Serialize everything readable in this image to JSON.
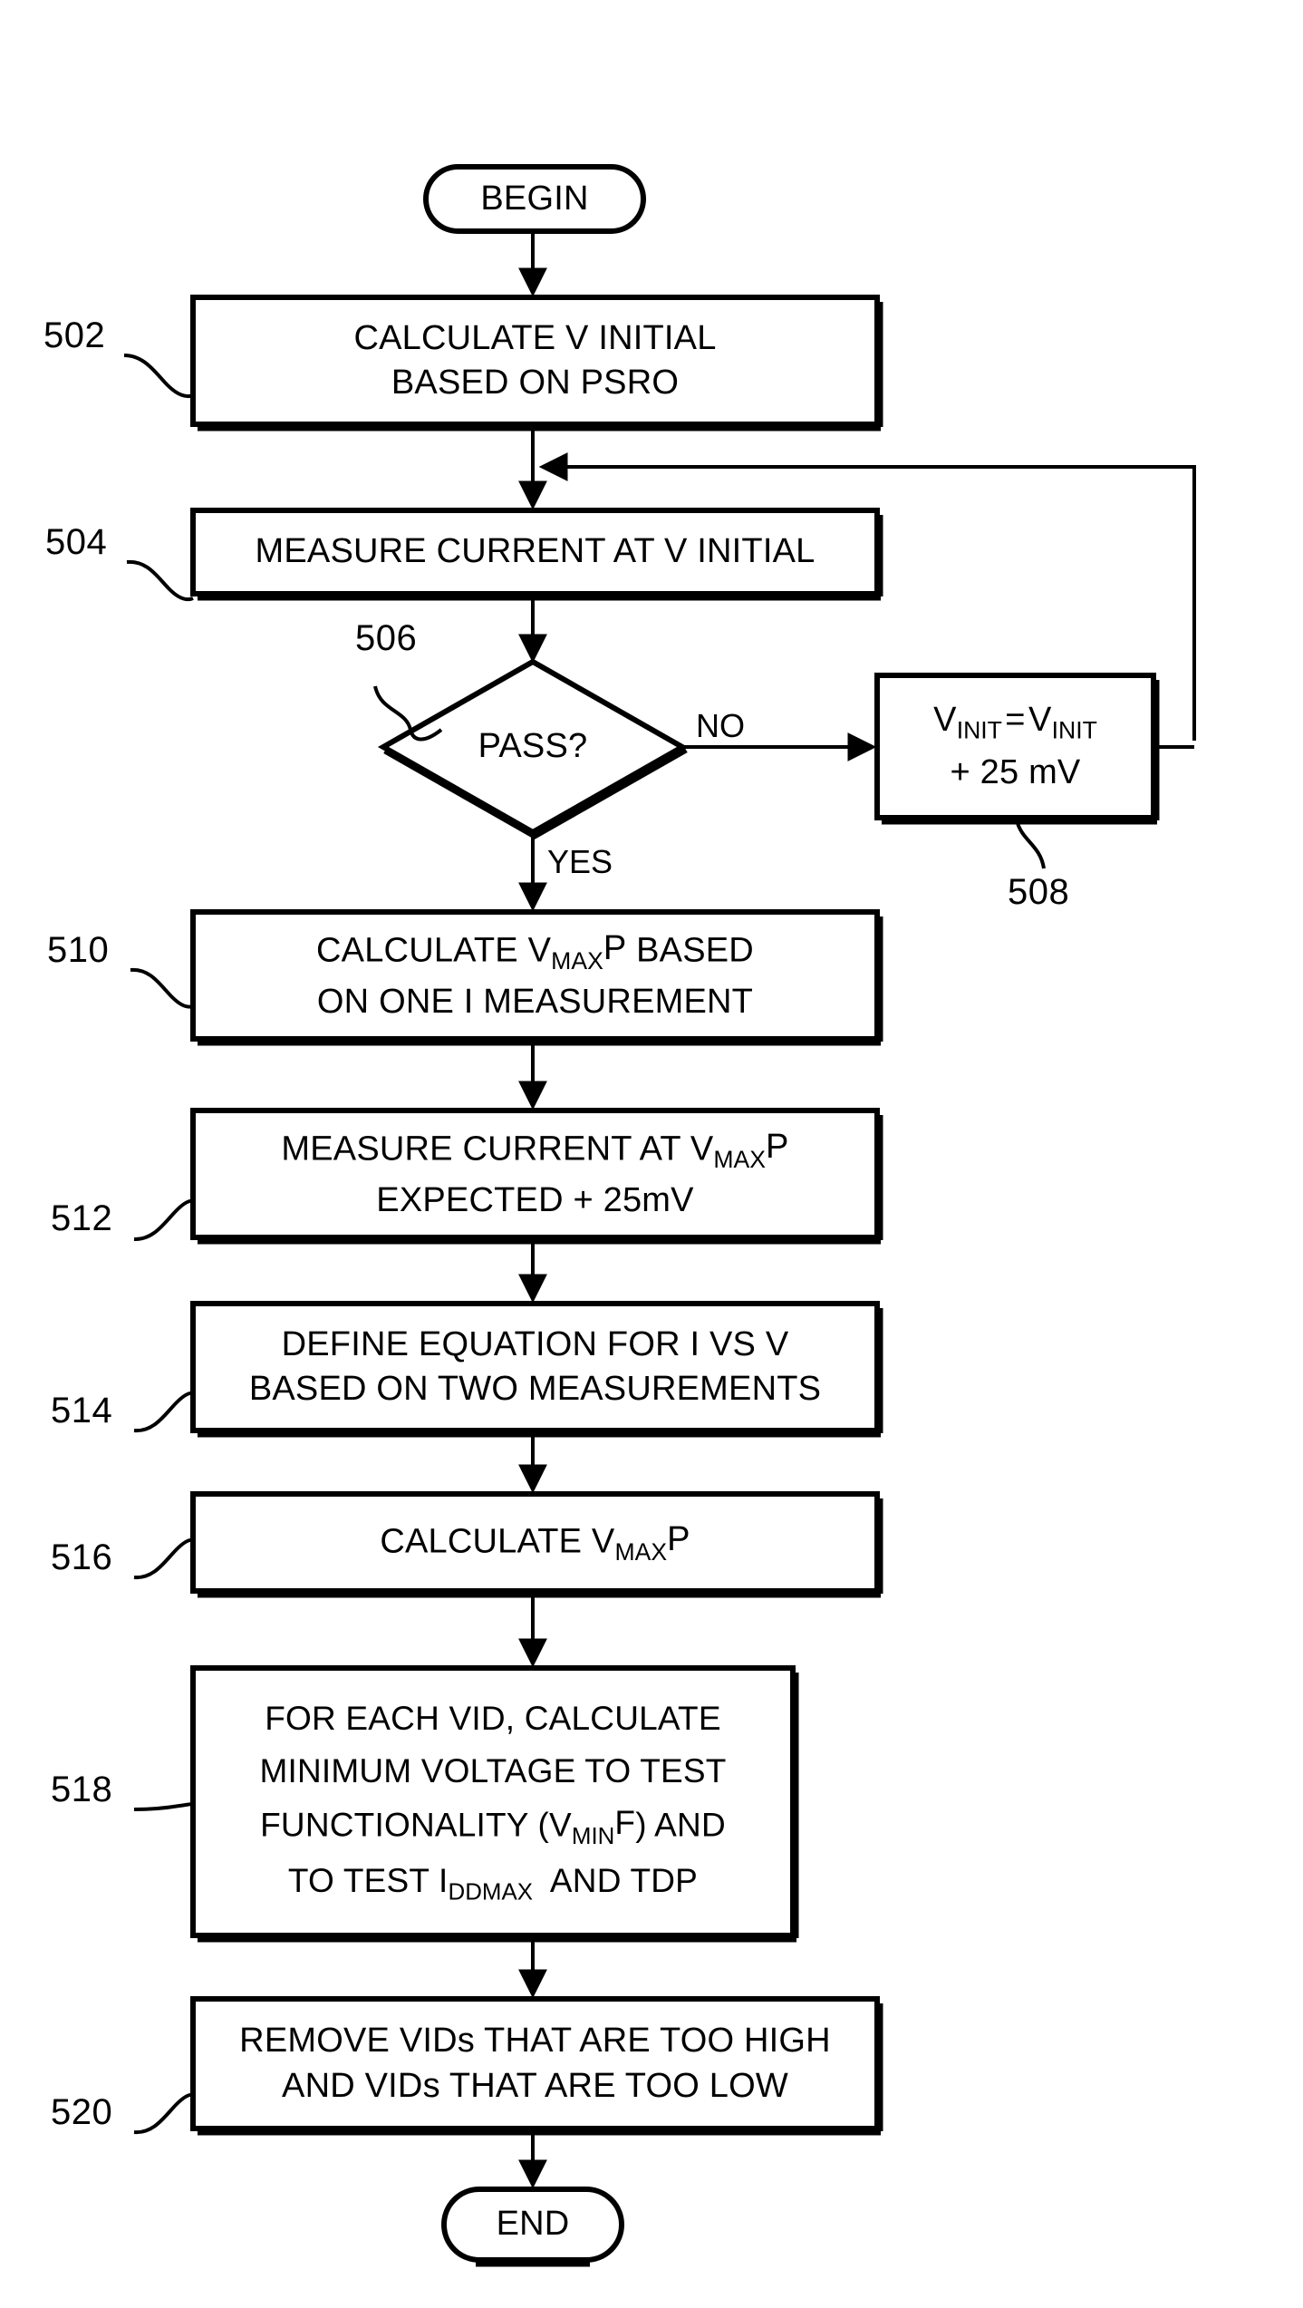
{
  "figure": {
    "kind": "patent-flowchart",
    "background_color": "#ffffff",
    "line_color": "#000000"
  },
  "terminals": {
    "begin": "BEGIN",
    "end": "END"
  },
  "nodes": [
    {
      "ref": "502",
      "shape": "process",
      "lines": [
        "CALCULATE V INITIAL",
        "BASED ON PSRO"
      ]
    },
    {
      "ref": "504",
      "shape": "process",
      "lines": [
        "MEASURE CURRENT AT V INITIAL"
      ]
    },
    {
      "ref": "506",
      "shape": "decision",
      "lines": [
        "PASS?"
      ]
    },
    {
      "ref": "508",
      "shape": "process",
      "lines": [
        "V_INIT = V_INIT",
        "+ 25 mV"
      ]
    },
    {
      "ref": "510",
      "shape": "process",
      "lines": [
        "CALCULATE V_MAX P BASED",
        "ON ONE I MEASUREMENT"
      ]
    },
    {
      "ref": "512",
      "shape": "process",
      "lines": [
        "MEASURE CURRENT AT V_MAX P",
        "EXPECTED + 25mV"
      ]
    },
    {
      "ref": "514",
      "shape": "process",
      "lines": [
        "DEFINE EQUATION FOR I VS V",
        "BASED ON TWO MEASUREMENTS"
      ]
    },
    {
      "ref": "516",
      "shape": "process",
      "lines": [
        "CALCULATE V_MAX P"
      ]
    },
    {
      "ref": "518",
      "shape": "process",
      "lines": [
        "FOR EACH VID, CALCULATE",
        "MINIMUM VOLTAGE TO TEST",
        "FUNCTIONALITY (V_MIN F) AND",
        "TO TEST I_DDMAX AND TDP"
      ]
    },
    {
      "ref": "520",
      "shape": "process",
      "lines": [
        "REMOVE VIDs THAT ARE TOO HIGH",
        "AND VIDs THAT ARE TOO LOW"
      ]
    }
  ],
  "edge_labels": {
    "no": "NO",
    "yes": "YES"
  },
  "refs": {
    "n502": "502",
    "n504": "504",
    "n506": "506",
    "n508": "508",
    "n510": "510",
    "n512": "512",
    "n514": "514",
    "n516": "516",
    "n518": "518",
    "n520": "520"
  },
  "text": {
    "begin": "BEGIN",
    "end": "END",
    "b502_l1": "CALCULATE V INITIAL",
    "b502_l2": "BASED ON PSRO",
    "b504_l1": "MEASURE CURRENT AT V INITIAL",
    "d506_l1": "PASS?",
    "b510_l2": "ON ONE I MEASUREMENT",
    "b512_l2": "EXPECTED + 25mV",
    "b514_l1": "DEFINE EQUATION FOR I VS V",
    "b514_l2": "BASED ON TWO MEASUREMENTS",
    "b518_l1": "FOR EACH VID, CALCULATE",
    "b518_l2": "MINIMUM VOLTAGE TO TEST",
    "b520_l1": "REMOVE VIDs THAT ARE TOO HIGH",
    "b520_l2": "AND VIDs THAT ARE TOO LOW",
    "label_no": "NO",
    "label_yes": "YES"
  }
}
